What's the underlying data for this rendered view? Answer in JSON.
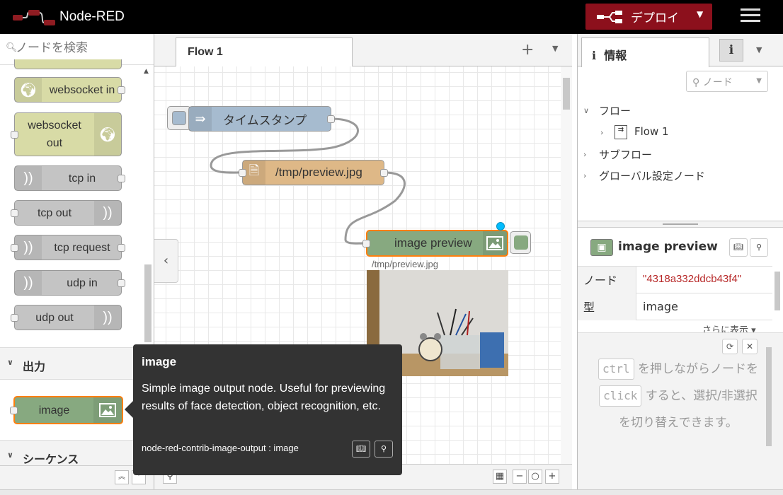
{
  "header": {
    "app_title": "Node-RED",
    "deploy_label": "デプロイ"
  },
  "palette": {
    "search_placeholder": "ノードを検索",
    "nodes": [
      {
        "label": "websocket in"
      },
      {
        "label": "websocket out"
      },
      {
        "label": "tcp in"
      },
      {
        "label": "tcp out"
      },
      {
        "label": "tcp request"
      },
      {
        "label": "udp in"
      },
      {
        "label": "udp out"
      }
    ],
    "categories": [
      "出力",
      "シーケンス"
    ],
    "output_nodes": [
      {
        "label": "image"
      }
    ]
  },
  "workspace": {
    "tab_label": "Flow 1",
    "nodes": [
      {
        "label": "タイムスタンプ"
      },
      {
        "label": "/tmp/preview.jpg"
      },
      {
        "label": "image preview"
      }
    ],
    "preview_caption": "/tmp/preview.jpg"
  },
  "tooltip": {
    "title": "image",
    "body": "Simple image output node. Useful for previewing results of face detection, object recognition, etc.",
    "module": "node-red-contrib-image-output : image"
  },
  "sidebar": {
    "tab_label": "情報",
    "info_tab_icon": "i",
    "search_placeholder": "ノード",
    "tree": {
      "flows": "フロー",
      "flow1": "Flow 1",
      "subflows": "サブフロー",
      "global_config": "グローバル設定ノード"
    },
    "selected": {
      "name": "image preview",
      "properties": [
        {
          "key": "ノード",
          "value": "\"4318a332ddcb43f4\""
        },
        {
          "key": "型",
          "value": "image"
        }
      ],
      "show_more": "さらに表示"
    },
    "help": {
      "kbd1": "ctrl",
      "text1": "を押しながらノードを",
      "kbd2": "click",
      "text2": "すると、選択/非選択を切り替えできます。"
    }
  },
  "colors": {
    "deploy": "#8c101c",
    "inject": "#a6bbcf",
    "file": "#deb887",
    "image": "#87a980",
    "websocket": "#d8dba6",
    "network": "#c4c4c4",
    "selection": "#ff7f0e"
  }
}
